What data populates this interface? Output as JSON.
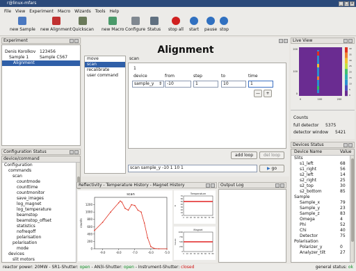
{
  "window": {
    "title": "r@linux-mfars"
  },
  "menu": [
    "File",
    "View",
    "Experiment",
    "Macro",
    "Wizards",
    "Tools",
    "Help"
  ],
  "toolbar": [
    {
      "label": "new Sample",
      "icon": "monitor-icon",
      "color": "#4a78c0"
    },
    {
      "label": "new Alignment",
      "icon": "alignment-icon",
      "color": "#c03030"
    },
    {
      "label": "Quickscan",
      "icon": "quickscan-icon",
      "color": "#6a7a5a"
    },
    {
      "label": "new Macro",
      "icon": "macro-icon",
      "color": "#4a9a6a"
    },
    {
      "label": "Configure",
      "icon": "tools-icon",
      "color": "#808890"
    },
    {
      "label": "Status",
      "icon": "status-icon",
      "color": "#607080"
    },
    {
      "label": "stop all",
      "icon": "stop-icon",
      "color": "#d02020"
    },
    {
      "label": "start",
      "icon": "start-icon",
      "color": "#3070c0"
    },
    {
      "label": "pause",
      "icon": "pause-icon",
      "color": "#3070c0"
    },
    {
      "label": "stop",
      "icon": "stop-icon",
      "color": "#3070c0"
    }
  ],
  "experiment": {
    "title": "Experiment",
    "rows": [
      {
        "name": "Denis Korolkov",
        "value": "123456"
      },
      {
        "name": "Sample 1",
        "value": "Sample C567"
      },
      {
        "name": "Alignment",
        "value": ""
      }
    ]
  },
  "config": {
    "title": "Configuration Status",
    "header": "device/command",
    "items": [
      "Configuration",
      "commands",
      "scan",
      "countmode",
      "counttime",
      "countmonitor",
      "save_images",
      "log_magnet",
      "log_temperature",
      "beamstop",
      "beamstop_offset",
      "statistics",
      "nofreqoff",
      "polarisation",
      "polarisation",
      "mode",
      "devices",
      "slit motors"
    ]
  },
  "alignment": {
    "title": "Alignment",
    "commands": [
      "move",
      "scan",
      "recalibrate",
      "user command"
    ],
    "scan_label": "scan",
    "scan_index": "1",
    "cols": [
      "device",
      "from",
      "step",
      "to",
      "time"
    ],
    "device": "sample_y",
    "from": "-10",
    "step": "1",
    "to": "10",
    "time": "1",
    "minus": "—",
    "plus": "+",
    "add_loop": "add loop",
    "del_loop": "del loop",
    "cmdline": "scan sample_y -10 1 10 1",
    "go": "go"
  },
  "liveview": {
    "title": "Live View",
    "counts_title": "Counts",
    "full_detector_label": "full detector",
    "full_detector": "5375",
    "window_label": "detector window",
    "window": "5421",
    "yticks": [
      "200",
      "100",
      "0"
    ],
    "xticks": [
      "0",
      "100",
      "200"
    ],
    "cticks": [
      "40",
      "35",
      "30",
      "25",
      "20",
      "15",
      "10",
      "5",
      "0"
    ]
  },
  "devices": {
    "title": "Devices Status",
    "col_name": "Device Name",
    "col_value": "Value",
    "rows": [
      {
        "name": "Slits",
        "value": "",
        "level": 0
      },
      {
        "name": "s1_left",
        "value": "68",
        "level": 1
      },
      {
        "name": "s1_right",
        "value": "56",
        "level": 1
      },
      {
        "name": "s2_left",
        "value": "14",
        "level": 1
      },
      {
        "name": "s2_right",
        "value": "25",
        "level": 1
      },
      {
        "name": "s2_top",
        "value": "30",
        "level": 1
      },
      {
        "name": "s2_bottom",
        "value": "85",
        "level": 1
      },
      {
        "name": "Sample",
        "value": "",
        "level": 0
      },
      {
        "name": "Sample_x",
        "value": "79",
        "level": 1
      },
      {
        "name": "Sample_y",
        "value": "23",
        "level": 1
      },
      {
        "name": "Sample_z",
        "value": "83",
        "level": 1
      },
      {
        "name": "Omega",
        "value": "4",
        "level": 1
      },
      {
        "name": "Phi",
        "value": "52",
        "level": 1
      },
      {
        "name": "Chi",
        "value": "40",
        "level": 1
      },
      {
        "name": "Detector",
        "value": "75",
        "level": 1
      },
      {
        "name": "Polarisation",
        "value": "",
        "level": 0
      },
      {
        "name": "Polarizer_y",
        "value": "0",
        "level": 1
      },
      {
        "name": "Analyzer_tilt",
        "value": "27",
        "level": 1
      }
    ]
  },
  "plots": {
    "title": "Reflectivity - Temperature History - Magnet History",
    "outputlog": "Output Log"
  },
  "chart_data": [
    {
      "type": "line",
      "title": "scan",
      "xlabel": "",
      "ylabel": "counts",
      "x": [
        -9.5,
        -9.0,
        -8.5,
        -8.0,
        -7.9,
        -7.8,
        -7.6,
        -7.4,
        -7.2,
        -7.0,
        -6.8,
        -6.6,
        -6.4,
        -6.2,
        -6.0,
        -5.8,
        -5.5,
        -5.0
      ],
      "y": [
        500,
        720,
        1000,
        1250,
        1300,
        1270,
        1100,
        1050,
        1200,
        1180,
        1050,
        1000,
        700,
        300,
        60,
        10,
        0,
        0
      ],
      "xlim": [
        -9.5,
        -5.0
      ],
      "ylim": [
        0,
        1400
      ],
      "xticks": [
        "-9.0",
        "-8.0",
        "-7.0",
        "-6.0",
        "-5.0"
      ],
      "yticks": [
        "0",
        "200",
        "400",
        "600",
        "800",
        "1000",
        "1200"
      ]
    },
    {
      "type": "line",
      "title": "Temperature",
      "ylabel": "K",
      "xlabel": "",
      "x": [
        0,
        10,
        20,
        30,
        40,
        50,
        60,
        70,
        80
      ],
      "y": [
        50,
        50,
        50,
        50,
        50,
        50,
        50,
        50,
        50
      ],
      "xticks": [
        "0",
        "10",
        "20",
        "30",
        "40",
        "50",
        "60",
        "70",
        "80"
      ],
      "yticks": [
        "0",
        "10",
        "20",
        "30",
        "40",
        "50",
        "60",
        "70"
      ]
    },
    {
      "type": "line",
      "title": "Magnet",
      "ylabel": "Gauss",
      "xlabel": "",
      "x": [
        0,
        10,
        20,
        30,
        40,
        50,
        60,
        70,
        80
      ],
      "y": [
        500,
        500,
        500,
        500,
        500,
        500,
        500,
        500,
        500
      ],
      "xticks": [
        "0",
        "10",
        "20",
        "30",
        "40",
        "50",
        "60",
        "70",
        "80"
      ],
      "yticks": [
        "0",
        "250",
        "500",
        "750",
        "1000"
      ]
    }
  ],
  "statusbar": {
    "power": "reactor power: 20MW",
    "sr1": "SR1-Shutter:",
    "sr1_state": "open",
    "an3": "AN3i-Shutter:",
    "an3_state": "open",
    "inst": "Instrument-Shutter:",
    "inst_state": "closed",
    "general": "general status:",
    "general_state": "ok"
  }
}
